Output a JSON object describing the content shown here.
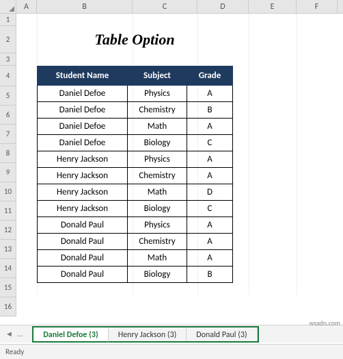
{
  "columns": [
    "A",
    "B",
    "C",
    "D",
    "E",
    "F"
  ],
  "row_numbers": [
    "1",
    "2",
    "3",
    "4",
    "5",
    "6",
    "7",
    "8",
    "9",
    "10",
    "11",
    "12",
    "13",
    "14",
    "15",
    "16"
  ],
  "title": "Table Option",
  "headers": {
    "name": "Student Name",
    "subject": "Subject",
    "grade": "Grade"
  },
  "rows": [
    {
      "name": "Daniel Defoe",
      "subject": "Physics",
      "grade": "A"
    },
    {
      "name": "Daniel Defoe",
      "subject": "Chemistry",
      "grade": "B"
    },
    {
      "name": "Daniel Defoe",
      "subject": "Math",
      "grade": "A"
    },
    {
      "name": "Daniel Defoe",
      "subject": "Biology",
      "grade": "C"
    },
    {
      "name": "Henry Jackson",
      "subject": "Physics",
      "grade": "A"
    },
    {
      "name": "Henry Jackson",
      "subject": "Chemistry",
      "grade": "A"
    },
    {
      "name": "Henry Jackson",
      "subject": "Math",
      "grade": "D"
    },
    {
      "name": "Henry Jackson",
      "subject": "Biology",
      "grade": "C"
    },
    {
      "name": "Donald Paul",
      "subject": "Physics",
      "grade": "A"
    },
    {
      "name": "Donald Paul",
      "subject": "Chemistry",
      "grade": "A"
    },
    {
      "name": "Donald Paul",
      "subject": "Math",
      "grade": "A"
    },
    {
      "name": "Donald Paul",
      "subject": "Biology",
      "grade": "B"
    }
  ],
  "tabs": [
    {
      "label": "Daniel Defoe (3)",
      "active": true
    },
    {
      "label": "Henry Jackson (3)",
      "active": false
    },
    {
      "label": "Donald Paul (3)",
      "active": false
    }
  ],
  "tab_nav": {
    "prev": "◄",
    "next": "►",
    "menu": "..."
  },
  "status": "Ready",
  "watermark": "wsxdn.com"
}
